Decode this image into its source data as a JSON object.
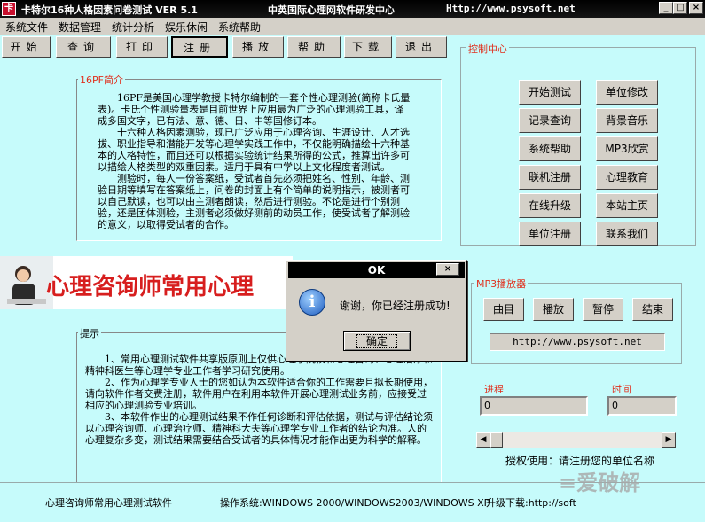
{
  "titlebar": {
    "title": "卡特尔16种人格因素问卷测试 VER 5.1",
    "center": "中英国际心理网软件研发中心",
    "url": "Http://www.psysoft.net",
    "min": "_",
    "max": "□",
    "close": "×"
  },
  "menu": [
    "系统文件",
    "数据管理",
    "统计分析",
    "娱乐休闲",
    "系统帮助"
  ],
  "toolbar": [
    "开始",
    "查询",
    "打印",
    "注册",
    "播放",
    "帮助",
    "下载",
    "退出"
  ],
  "intro": {
    "label": "16PF简介",
    "paragraphs": [
      "16PF是美国心理学教授卡特尔编制的一套个性心理测验(简称卡氏量表)。卡氏个性测验量表是目前世界上应用最为广泛的心理测验工具，译成多国文字，已有法、意、德、日、中等国修订本。",
      "十六种人格因素测验，现已广泛应用于心理咨询、生涯设计、人才选拔、职业指导和潜能开发等心理学实践工作中，不仅能明确描绘十六种基本的人格特性，而且还可以根据实验统计结果所得的公式，推算出许多可以描绘人格类型的双重因素。适用于具有中学以上文化程度者测试。",
      "测验时，每人一份答案纸，受试者首先必须把姓名、性别、年龄、测验日期等填写在答案纸上，问卷的封面上有个简单的说明指示，被测者可以自己默读，也可以由主测者朗读，然后进行测验。不论是进行个别测验，还是团体测验，主测者必须做好测前的动员工作，使受试者了解测验的意义，以取得受试者的合作。"
    ]
  },
  "banner": "心理咨询师常用心理",
  "tips": {
    "label": "提示",
    "paragraphs": [
      "1、常用心理测试软件共享版原则上仅供心理学院校和心理咨询、心理治疗和精神科医生等心理学专业工作者学习研究使用。",
      "2、作为心理学专业人士的您如认为本软件适合你的工作需要且拟长期使用，请向软件作者交费注册，软件用户在利用本软件开展心理测试业务前，应接受过相应的心理测验专业培训。",
      "3、本软件作出的心理测试结果不作任何诊断和评估依据，测试与评估结论须以心理咨询师、心理治疗师、精神科大夫等心理学专业工作者的结论为准。人的心理复杂多变，测试结果需要结合受试者的具体情况才能作出更为科学的解释。"
    ]
  },
  "control": {
    "label": "控制中心",
    "buttons": [
      "开始测试",
      "单位修改",
      "记录查询",
      "背景音乐",
      "系统帮助",
      "MP3欣赏",
      "联机注册",
      "心理教育",
      "在线升级",
      "本站主页",
      "单位注册",
      "联系我们"
    ]
  },
  "mp3": {
    "label": "MP3播放器",
    "buttons": [
      "曲目",
      "播放",
      "暂停",
      "结束"
    ],
    "url": "http://www.psysoft.net"
  },
  "progress": {
    "label": "进程",
    "value": "0"
  },
  "time": {
    "label": "时间",
    "value": "0"
  },
  "license": "授权使用：请注册您的单位名称",
  "status": {
    "left": "心理咨询师常用心理测试软件",
    "os": "操作系统:WINDOWS 2000/WINDOWS2003/WINDOWS XP",
    "upgrade": "升级下载:http://soft"
  },
  "dialog": {
    "title": "OK",
    "message": "谢谢，你已经注册成功!",
    "ok": "确定",
    "icon": "i"
  },
  "watermark": "≡爱破解"
}
